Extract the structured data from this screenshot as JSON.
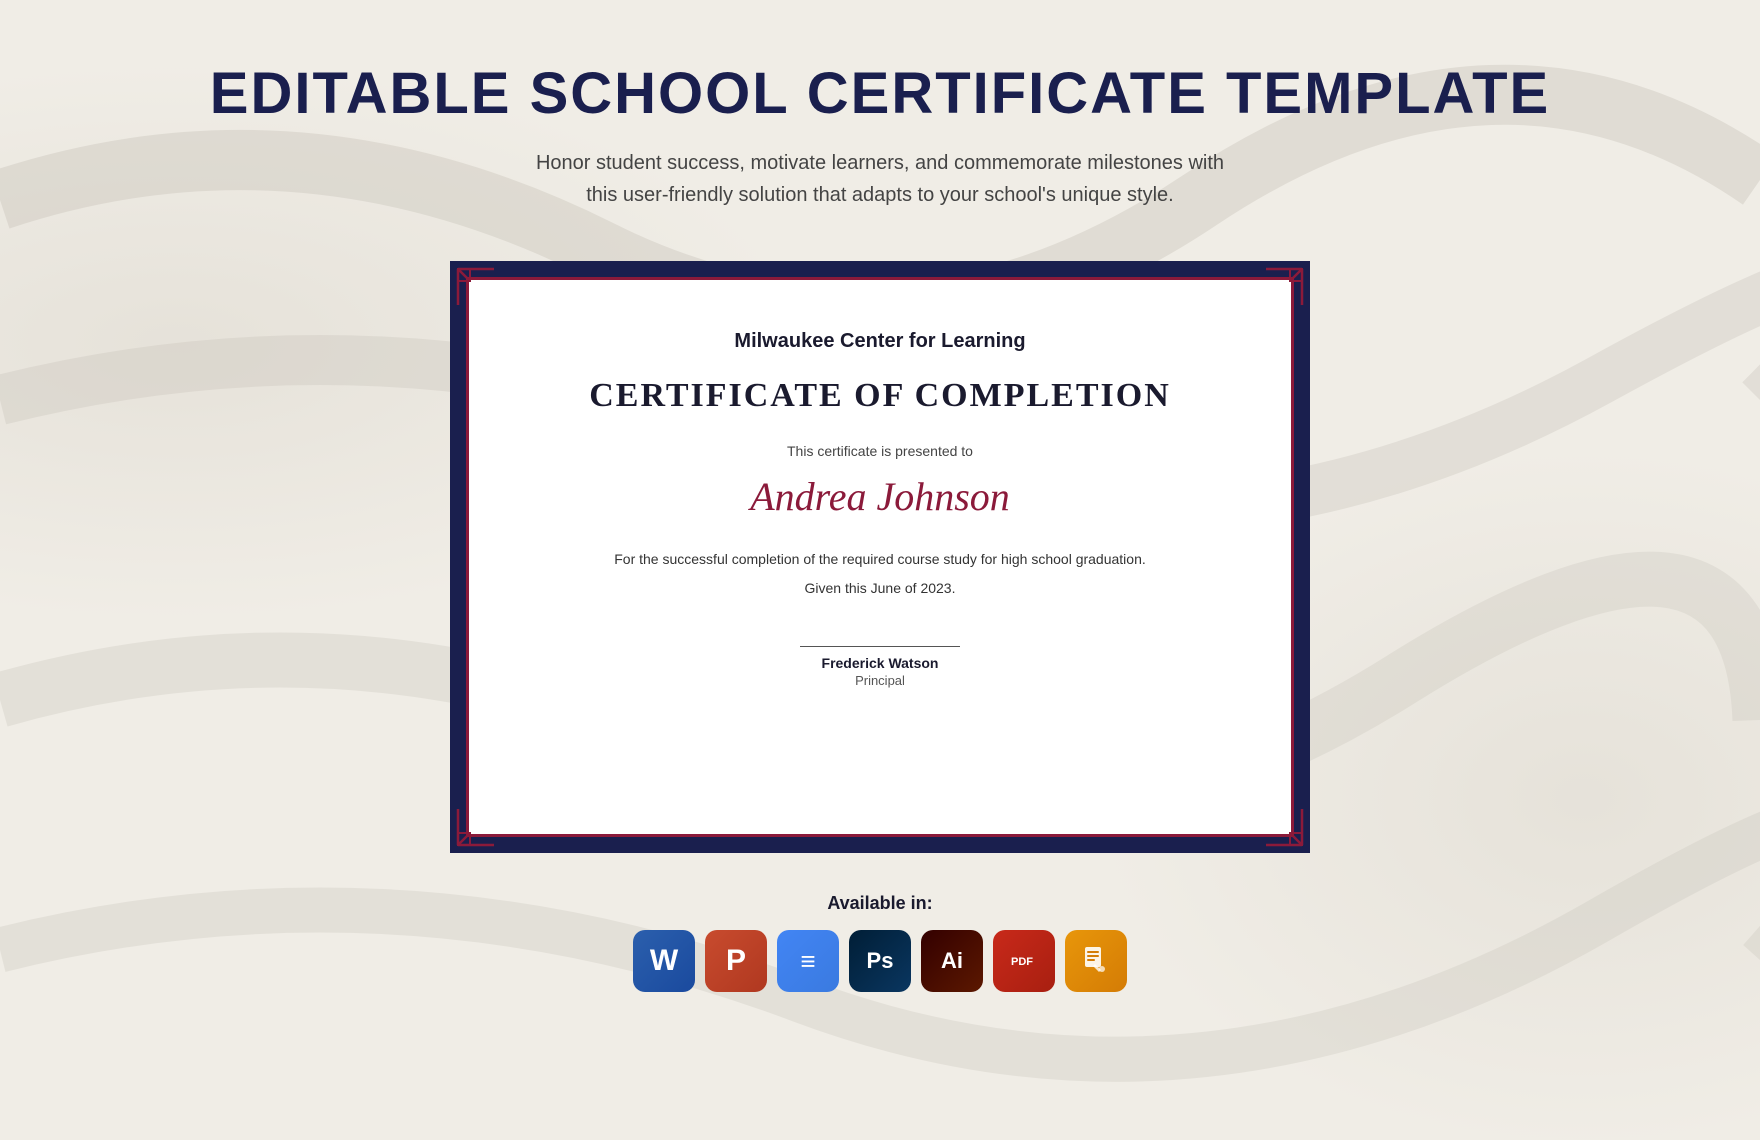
{
  "page": {
    "title": "Editable School Certificate Template",
    "subtitle": "Honor student success, motivate learners, and commemorate milestones with this user-friendly solution that adapts to your school's unique style.",
    "background_color": "#f0ede6"
  },
  "certificate": {
    "institution": "Milwaukee Center for Learning",
    "title": "Certificate of Completion",
    "presented_text": "This certificate is presented to",
    "recipient_name": "Andrea Johnson",
    "description": "For the successful completion of the required course study for high school graduation.",
    "date": "Given this June of 2023.",
    "signer_name": "Frederick Watson",
    "signer_title": "Principal"
  },
  "available_section": {
    "label": "Available in:",
    "icons": [
      {
        "name": "Word",
        "type": "word"
      },
      {
        "name": "PowerPoint",
        "type": "powerpoint"
      },
      {
        "name": "Google Docs",
        "type": "docs"
      },
      {
        "name": "Photoshop",
        "type": "photoshop"
      },
      {
        "name": "Illustrator",
        "type": "illustrator"
      },
      {
        "name": "Acrobat PDF",
        "type": "acrobat"
      },
      {
        "name": "Pages",
        "type": "pages"
      }
    ]
  }
}
